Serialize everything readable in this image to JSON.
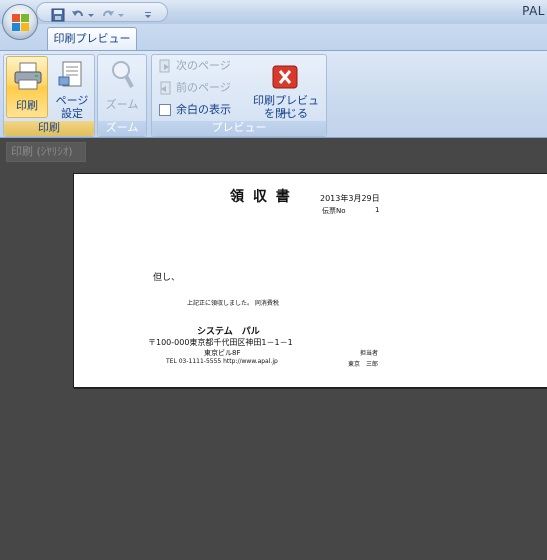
{
  "window": {
    "app_title": "PAL"
  },
  "ribbon": {
    "tab_label": "印刷プレビュー",
    "groups": {
      "print": {
        "label": "印刷",
        "print_button": "印刷",
        "page_setup_line1": "ページ",
        "page_setup_line2": "設定"
      },
      "zoom": {
        "label": "ズーム",
        "zoom_button": "ズーム"
      },
      "preview": {
        "label": "プレビュー",
        "next_page": "次のページ",
        "prev_page": "前のページ",
        "show_margin": "余白の表示",
        "close_line1": "印刷プレビュー",
        "close_line2": "を閉じる"
      }
    }
  },
  "document_tab": "印刷 (ｼﾔﾘｼｵ)",
  "receipt": {
    "title": "領 収 書",
    "date": "2013年3月29日",
    "slip_no_label": "伝票No",
    "slip_no": "1",
    "memo_label": "但し、",
    "received_text": "上記正に領収しました。 同消費税",
    "company_name": "システム　パル",
    "address_line1": "〒100-000東京都千代田区神田1－1－1",
    "address_line2": "東京ビル8F",
    "contact": "TEL 03-1111-5555  http://www.apal.jp",
    "staff_label": "担当者",
    "staff_name": "東京　三郎"
  },
  "colors": {
    "ribbon_text": "#15428b",
    "selected_button": "#ffd86b",
    "workspace": "#474747",
    "close_icon": "#d9392b"
  }
}
